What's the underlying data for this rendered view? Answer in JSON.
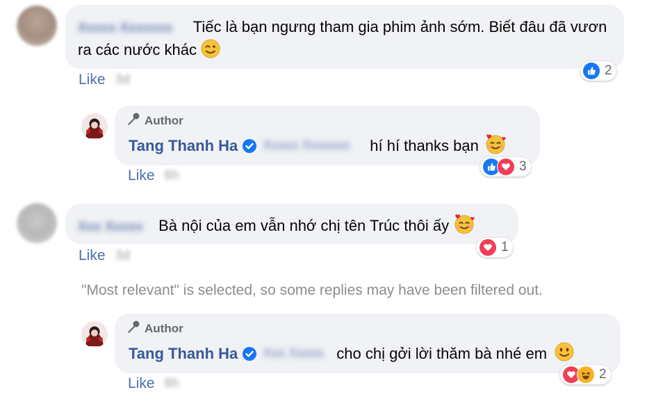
{
  "comments": [
    {
      "text": "Tiếc là bạn ngưng tham gia phim ảnh sớm. Biết đâu đã vươn ra các nước khác",
      "emoji": "wink-emoji",
      "like_label": "Like",
      "reaction_count": "2",
      "reactions": [
        "like"
      ],
      "reply": {
        "author_tag": "Author",
        "name": "Tang Thanh Ha",
        "text": "hí hí thanks bạn",
        "emoji": "smiling-face-with-hearts",
        "like_label": "Like",
        "reaction_count": "3",
        "reactions": [
          "like",
          "love"
        ]
      }
    },
    {
      "text": "Bà nội của em vẫn nhớ chị tên Trúc thôi ấy",
      "emoji": "smiling-face-with-hearts",
      "like_label": "Like",
      "reaction_count": "1",
      "reactions": [
        "love"
      ],
      "filter_note": "\"Most relevant\" is selected, so some replies may have been filtered out.",
      "reply": {
        "author_tag": "Author",
        "name": "Tang Thanh Ha",
        "text": "cho chị gởi lời thăm bà nhé em",
        "emoji": "slightly-smiling-face",
        "like_label": "Like",
        "reaction_count": "2",
        "reactions": [
          "love",
          "haha"
        ]
      }
    }
  ],
  "colors": {
    "bubble_bg": "#f0f2f5",
    "name_blue": "#385898",
    "like_blue": "#4b6db1",
    "verified_blue": "#1877f2",
    "love_red": "#f33e58",
    "haha_yellow": "#f7b125"
  }
}
